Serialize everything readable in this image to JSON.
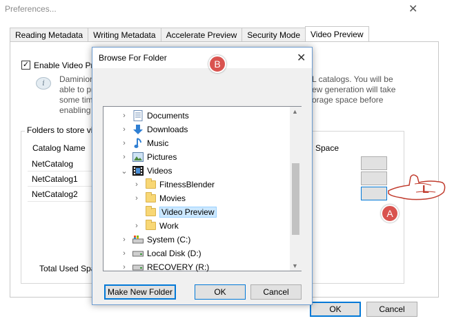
{
  "preferences": {
    "title": "Preferences...",
    "tabs": [
      "Reading Metadata",
      "Writing Metadata",
      "Accelerate Preview",
      "Security Mode",
      "Video Preview"
    ],
    "active_tab": "Video Preview",
    "enable_label": "Enable Video Pre",
    "info_left": [
      "Daminion",
      "able to pr",
      "some tim",
      "enabling"
    ],
    "info_right": [
      "L catalogs.  You will be",
      "ew generation will take",
      "orage space before"
    ],
    "folders_group_label": "Folders to store vi",
    "catalog_header": "Catalog Name",
    "space_header": "Space",
    "catalogs": [
      "NetCatalog",
      "NetCatalog1",
      "NetCatalog2"
    ],
    "total_used_label": "Total Used Spa",
    "ok_label": "OK",
    "cancel_label": "Cancel"
  },
  "browse": {
    "title": "Browse For Folder",
    "tree": [
      {
        "label": "Documents",
        "icon": "documents-icon",
        "chevron": "›",
        "indent": 0
      },
      {
        "label": "Downloads",
        "icon": "download-arrow-icon",
        "chevron": "›",
        "indent": 0
      },
      {
        "label": "Music",
        "icon": "music-note-icon",
        "chevron": "›",
        "indent": 0
      },
      {
        "label": "Pictures",
        "icon": "pictures-icon",
        "chevron": "›",
        "indent": 0
      },
      {
        "label": "Videos",
        "icon": "videos-icon",
        "chevron": "⌄",
        "indent": 0
      },
      {
        "label": "FitnessBlender",
        "icon": "folder-icon",
        "chevron": "›",
        "indent": 1
      },
      {
        "label": "Movies",
        "icon": "folder-icon",
        "chevron": "›",
        "indent": 1
      },
      {
        "label": "Video Preview",
        "icon": "folder-icon",
        "chevron": "",
        "indent": 1,
        "selected": true
      },
      {
        "label": "Work",
        "icon": "folder-icon",
        "chevron": "›",
        "indent": 1
      },
      {
        "label": "System (C:)",
        "icon": "system-drive-icon",
        "chevron": "›",
        "indent": 0
      },
      {
        "label": "Local Disk (D:)",
        "icon": "drive-icon",
        "chevron": "›",
        "indent": 0
      },
      {
        "label": "RECOVERY (R:)",
        "icon": "drive-icon",
        "chevron": "›",
        "indent": 0
      }
    ],
    "make_new_folder_label": "Make New Folder",
    "ok_label": "OK",
    "cancel_label": "Cancel"
  },
  "annotations": {
    "badge_a": "A",
    "badge_b": "B",
    "hand_letter": "L",
    "badge_color": "#d9534f"
  }
}
